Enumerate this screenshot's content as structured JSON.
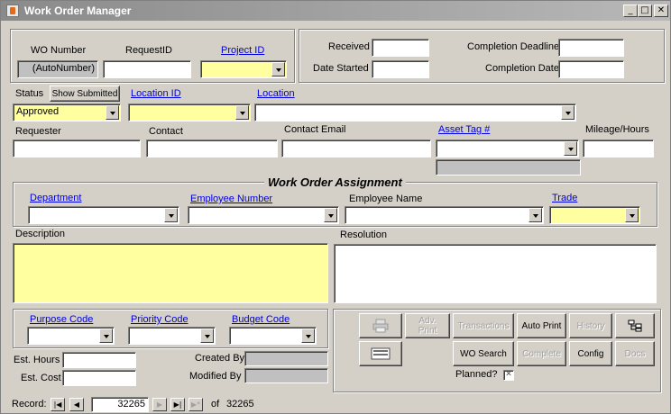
{
  "window": {
    "title": "Work Order Manager",
    "controls": [
      "minimize-icon",
      "maximize-icon",
      "close-icon"
    ]
  },
  "header_left": {
    "wo_number_label": "WO Number",
    "wo_number_value": "(AutoNumber)",
    "request_id_label": "RequestID",
    "request_id_value": "",
    "project_id_label": "Project ID",
    "project_id_value": ""
  },
  "header_right": {
    "received_label": "Received",
    "date_started_label": "Date Started",
    "completion_deadline_label": "Completion Deadline",
    "completion_date_label": "Completion Date"
  },
  "status": {
    "label": "Status",
    "show_submitted_label": "Show Submitted",
    "value": "Approved",
    "location_id_label": "Location ID",
    "location_label": "Location"
  },
  "contact": {
    "requester_label": "Requester",
    "contact_label": "Contact",
    "contact_email_label": "Contact Email",
    "asset_tag_label": "Asset Tag #",
    "mileage_label": "Mileage/Hours"
  },
  "assignment": {
    "title": "Work Order Assignment",
    "department_label": "Department",
    "employee_number_label": "Employee Number",
    "employee_name_label": "Employee Name",
    "trade_label": "Trade"
  },
  "notes": {
    "description_label": "Description",
    "resolution_label": "Resolution"
  },
  "codes": {
    "purpose_label": "Purpose Code",
    "priority_label": "Priority Code",
    "budget_label": "Budget Code"
  },
  "bottom_fields": {
    "est_hours_label": "Est. Hours",
    "est_cost_label": "Est. Cost",
    "created_by_label": "Created By",
    "modified_by_label": "Modified By"
  },
  "actions": {
    "adv_print": "Adv.\nPrint",
    "transactions": "Transactions",
    "auto_print": "Auto Print",
    "history": "History",
    "wo_search": "WO Search",
    "complete": "Complete",
    "config": "Config",
    "docs": "Docs",
    "planned_label": "Planned?"
  },
  "record_nav": {
    "label": "Record:",
    "current": "32265",
    "of_label": "of",
    "total": "32265"
  },
  "colors": {
    "required_field": "#ffff9f",
    "form_bg": "#d4d0c8",
    "link": "#0000e0"
  }
}
